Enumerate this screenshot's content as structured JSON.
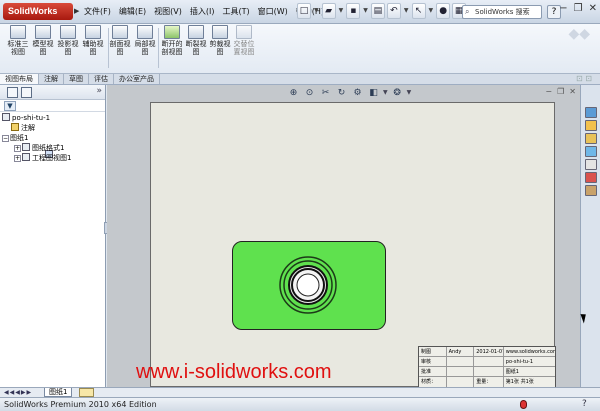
{
  "app": {
    "logo": "SolidWorks"
  },
  "menu": [
    {
      "label": "文件(F)"
    },
    {
      "label": "编辑(E)"
    },
    {
      "label": "视图(V)"
    },
    {
      "label": "插入(I)"
    },
    {
      "label": "工具(T)"
    },
    {
      "label": "窗口(W)"
    },
    {
      "label": "帮助(H)"
    }
  ],
  "search": {
    "text": "SolidWorks 搜索"
  },
  "ribbon": {
    "buttons": [
      {
        "label": "标准三视图"
      },
      {
        "label": "模型视图"
      },
      {
        "label": "投影视图"
      },
      {
        "label": "辅助视图"
      },
      {
        "label": "剖面视图"
      },
      {
        "label": "局部视图"
      },
      {
        "label": "断开的剖视图"
      },
      {
        "label": "断裂视图"
      },
      {
        "label": "剪裁视图"
      },
      {
        "label": "交替位置视图"
      }
    ]
  },
  "tabs": [
    {
      "label": "视图布局",
      "active": true
    },
    {
      "label": "注解"
    },
    {
      "label": "草图"
    },
    {
      "label": "评估"
    },
    {
      "label": "办公室产品"
    }
  ],
  "tree": {
    "root": "po-shi-tu-1",
    "items": [
      {
        "label": "注解"
      },
      {
        "label": "图纸1"
      },
      {
        "label": "图纸格式1"
      },
      {
        "label": "工程图视图1"
      }
    ]
  },
  "title_block": {
    "rows": [
      [
        "制图",
        "Andy",
        "2012-01-07",
        "www.solidworks.com"
      ],
      [
        "审核",
        "",
        "",
        "po-shi-tu-1"
      ],
      [
        "批准",
        "",
        "",
        "图纸1"
      ],
      [
        "材质：",
        "",
        "重量：",
        "第1张 共1张"
      ]
    ]
  },
  "sheet_tab": {
    "label": "图纸1"
  },
  "status": {
    "text": "SolidWorks Premium 2010 x64 Edition"
  },
  "watermark": {
    "text": "www.i-solidworks.com"
  },
  "colors": {
    "part_fill": "#5fe14e",
    "watermark": "#e01010"
  }
}
